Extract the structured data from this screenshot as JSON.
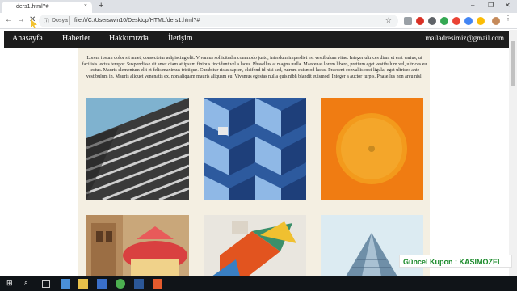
{
  "browser": {
    "tab_title": "ders1.html?#",
    "tab_close": "×",
    "new_tab": "+",
    "window_controls": {
      "minimize": "–",
      "maximize": "❐",
      "close": "✕"
    },
    "nav": {
      "back": "←",
      "forward": "→",
      "stop": "✕"
    },
    "omnibox": {
      "info": "ⓘ",
      "scheme_label": "Dosya",
      "url": "file:///C:/Users/win10/Desktop/HTML/ders1.html?#",
      "star": "☆"
    }
  },
  "page": {
    "nav_links": [
      "Anasayfa",
      "Haberler",
      "Hakkımızda",
      "İletişim"
    ],
    "email": "mailadresimiz@gmail.com",
    "intro_text": "Lorem ipsum dolor sit amet, consectetur adipiscing elit. Vivamus sollicitudin commodo justo, interdum imperdiet est vestibulum vitae. Integer ultrices diam et erat varius, ut facilisis lectus tempor. Suspendisse sit amet diam at ipsum finibus tincidunt vel a lacus. Phasellus at magna nulla. Maecenas lorem libero, pretium eget vestibulum vel, ultrices eu lectus. Mauris elementum elit et felis maximus tristique. Curabitur risus sapien, eleifend id nisi sed, rutrum euismod lacus. Praesent convallis orci ligula, eget ultrices ante vestibulum in. Mauris aliquet venenatis ex, non aliquam mauris aliquam eu. Vivamus egestas nulla quis nibh blandit euismod. Integer a auctor turpis. Phasellus non arcu nisl.",
    "photos": [
      "building-facade-photo",
      "blue-cubes-photo",
      "orange-fruit-photo",
      "carousel-photo",
      "geometric-shapes-photo",
      "tower-photo"
    ]
  },
  "overlay": {
    "coupon": "Güncel Kupon : KASIMOZEL"
  },
  "colors": {
    "navbar": "#1c1c1c",
    "content_bg": "#f4efe2",
    "coupon_text": "#1a8a2a"
  }
}
